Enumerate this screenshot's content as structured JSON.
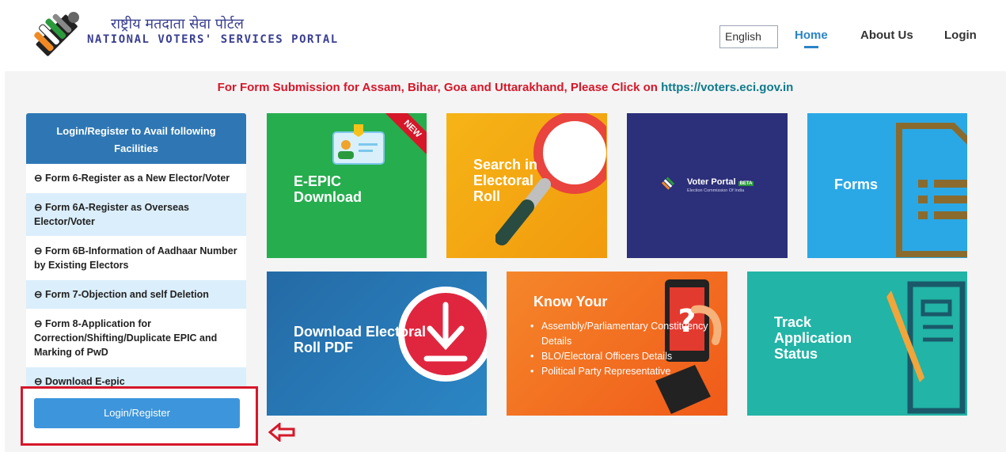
{
  "header": {
    "brand_hindi": "राष्ट्रीय मतदाता सेवा पोर्टल",
    "brand_english": "NATIONAL VOTERS' SERVICES PORTAL",
    "language": "English",
    "nav": {
      "home": "Home",
      "about": "About Us",
      "login": "Login"
    }
  },
  "notice": {
    "text": "For Form Submission for Assam, Bihar, Goa and Uttarakhand, Please Click on ",
    "link": "https://voters.eci.gov.in"
  },
  "sidebar": {
    "heading": "Login/Register to Avail following Facilities",
    "items": [
      "Form 6-Register as a New Elector/Voter",
      "Form 6A-Register as Overseas Elector/Voter",
      "Form 6B-Information of Aadhaar Number by Existing Electors",
      "Form 7-Objection and self Deletion",
      "Form 8-Application for Correction/Shifting/Duplicate EPIC and Marking of PwD",
      "Download E-epic"
    ],
    "button": "Login/Register"
  },
  "tiles": {
    "epic": {
      "label": "E-EPIC Download",
      "badge": "NEW"
    },
    "search": {
      "label": "Search in Electoral Roll"
    },
    "voter": {
      "label": "Voter Portal",
      "badge": "BETA",
      "sub": "Election Commission Of India"
    },
    "forms": {
      "label": "Forms"
    },
    "roll": {
      "label": "Download Electoral Roll PDF"
    },
    "know": {
      "label": "Know Your",
      "items": [
        "Assembly/Parliamentary Constituency Details",
        "BLO/Electoral Officers Details",
        "Political Party Representative"
      ]
    },
    "track": {
      "label": "Track Application Status"
    }
  },
  "colors": {
    "accent": "#2b84c6",
    "notice_red": "#d6172a",
    "sidebar_header": "#2e77b4",
    "epic_tile": "#26ad4e",
    "search_tile": "#f6b417",
    "voter_tile": "#2c2f79",
    "forms_tile": "#2aa8e6",
    "roll_tile": "#246aa6",
    "know_tile": "#f5862a",
    "track_tile": "#22b4a6"
  }
}
